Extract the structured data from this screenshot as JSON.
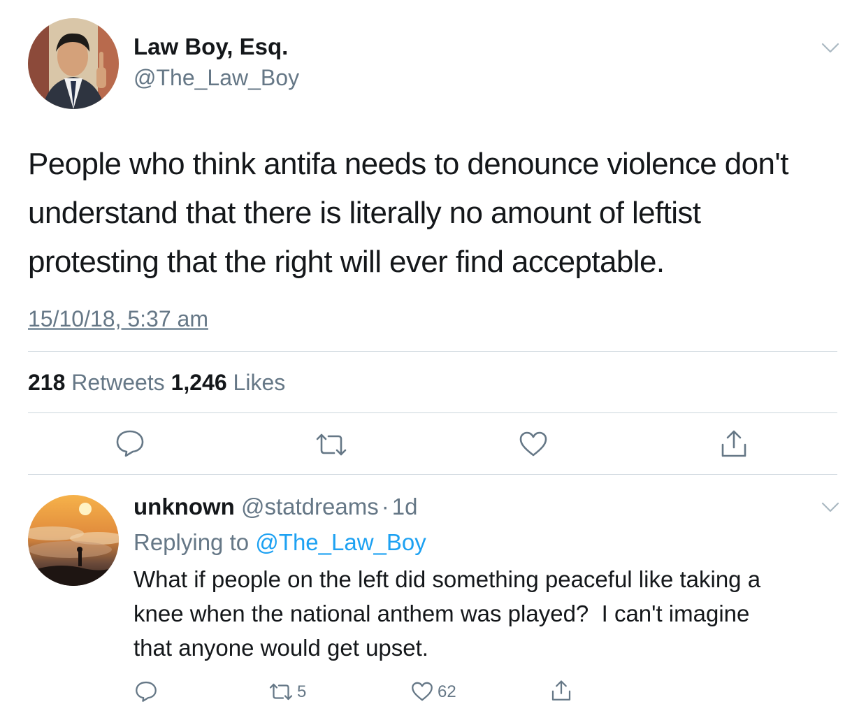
{
  "tweet": {
    "author_name": "Law Boy, Esq.",
    "author_handle": "@The_Law_Boy",
    "text": "People who think antifa needs to denounce violence don't understand that there is literally no amount of leftist protesting that the right will ever find acceptable.",
    "timestamp": "15/10/18, 5:37 am",
    "retweets_count": "218",
    "retweets_label": "Retweets",
    "likes_count": "1,246",
    "likes_label": "Likes"
  },
  "reply": {
    "author_name": "unknown",
    "author_handle": "@statdreams",
    "separator": "·",
    "time": "1d",
    "replying_prefix": "Replying to",
    "replying_handle": "@The_Law_Boy",
    "text": "What if people on the left did something peaceful like taking a knee when the national anthem was played?  I can't imagine that anyone would get upset.",
    "retweets_count": "5",
    "likes_count": "62"
  },
  "icons": {
    "reply": "reply-icon",
    "retweet": "retweet-icon",
    "like": "heart-icon",
    "share": "share-icon",
    "menu": "chevron-down-icon"
  },
  "colors": {
    "text": "#14171a",
    "secondary": "#657786",
    "link": "#1da1f2",
    "divider": "#ccd6dd"
  }
}
